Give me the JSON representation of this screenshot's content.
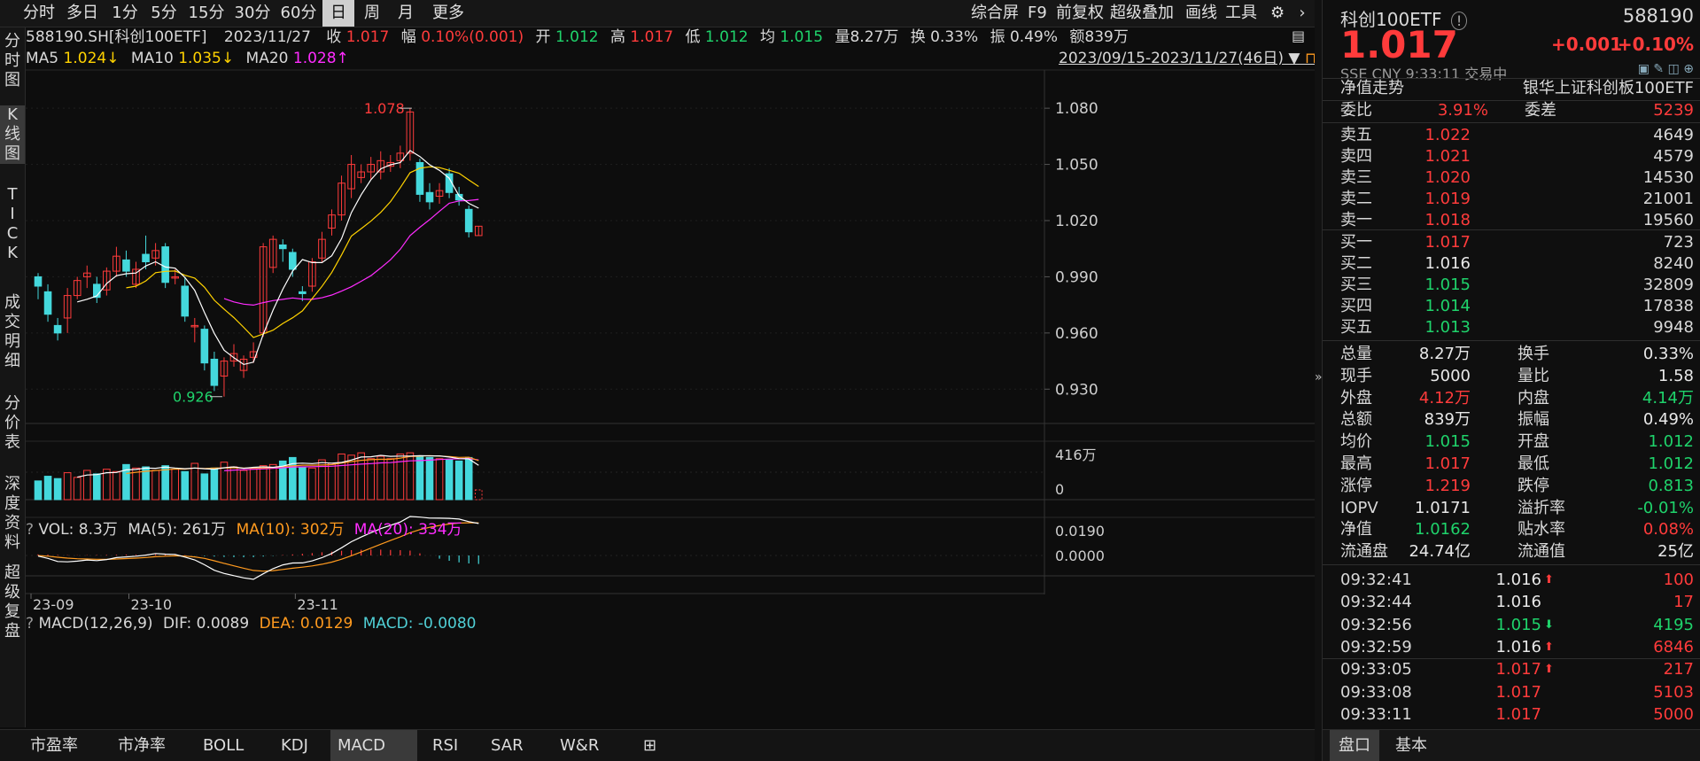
{
  "toolbar": {
    "periods": [
      "分时",
      "多日",
      "1分",
      "5分",
      "15分",
      "30分",
      "60分",
      "日",
      "周",
      "月",
      "更多"
    ],
    "active_period": "日",
    "right_tools": [
      "综合屏",
      "F9",
      "前复权",
      "超级叠加",
      "画线",
      "工具"
    ]
  },
  "sidebar": {
    "items": [
      "分时图",
      "K线图",
      "TICK",
      "成交明细",
      "分价表",
      "深度资料",
      "超级复盘"
    ],
    "active": "K线图"
  },
  "info": {
    "code": "588190.SH[科创100ETF]",
    "date": "2023/11/27",
    "close_label": "收",
    "close": "1.017",
    "change_label": "幅",
    "change": "0.10%(0.001)",
    "open_label": "开",
    "open": "1.012",
    "high_label": "高",
    "high": "1.017",
    "low_label": "低",
    "low": "1.012",
    "avg_label": "均",
    "avg": "1.015",
    "vol_label": "量",
    "vol": "8.27万",
    "turnover_label": "换",
    "turnover": "0.33%",
    "amp_label": "振",
    "amp": "0.49%",
    "amount_label": "额",
    "amount": "839万",
    "range": "2023/09/15-2023/11/27(46日)"
  },
  "ma": {
    "ma5_label": "MA5",
    "ma5": "1.024↓",
    "ma10_label": "MA10",
    "ma10": "1.035↓",
    "ma20_label": "MA20",
    "ma20": "1.028↑"
  },
  "vol_line": {
    "label": "VOL: 8.3万",
    "ma5": "MA(5): 261万",
    "ma10": "MA(10): 302万",
    "ma20": "MA(20): 334万",
    "axis_top": "416万",
    "axis_zero": "0"
  },
  "macd_line": {
    "label": "MACD(12,26,9)",
    "dif": "DIF: 0.0089",
    "dea": "DEA: 0.0129",
    "macd": "MACD: -0.0080",
    "axis_top": "0.0190",
    "axis_zero": "0.0000"
  },
  "kline_axis": [
    "1.080",
    "1.050",
    "1.020",
    "0.990",
    "0.960",
    "0.930"
  ],
  "xaxis": [
    "23-09",
    "23-10",
    "23-11"
  ],
  "annotations": {
    "high": "1.078",
    "low": "0.926"
  },
  "colors": {
    "up": "#ff3b3b",
    "down": "#44d8dc",
    "ma5": "#ffffff",
    "ma10": "#ffd200",
    "ma20": "#ff2cff",
    "bg": "#0d0d0d"
  },
  "bottom_tabs": [
    "市盈率",
    "市净率",
    "BOLL",
    "KDJ",
    "MACD",
    "RSI",
    "SAR",
    "W&R"
  ],
  "active_tab": "MACD",
  "quote": {
    "name": "科创100ETF",
    "code": "588190",
    "price": "1.017",
    "change": "+0.001",
    "change_pct": "+0.10%",
    "market": "SSE  CNY  9:33:11  交易中",
    "nav_trend": "净值走势",
    "index_name": "银华上证科创板100ETF",
    "wb_label": "委比",
    "wb": "3.91%",
    "wc_label": "委差",
    "wc": "5239"
  },
  "orderbook": {
    "sells": [
      {
        "label": "卖五",
        "price": "1.022",
        "vol": "4649"
      },
      {
        "label": "卖四",
        "price": "1.021",
        "vol": "4579"
      },
      {
        "label": "卖三",
        "price": "1.020",
        "vol": "14530"
      },
      {
        "label": "卖二",
        "price": "1.019",
        "vol": "21001"
      },
      {
        "label": "卖一",
        "price": "1.018",
        "vol": "19560"
      }
    ],
    "buys": [
      {
        "label": "买一",
        "price": "1.017",
        "vol": "723",
        "color": "red"
      },
      {
        "label": "买二",
        "price": "1.016",
        "vol": "8240",
        "color": "white"
      },
      {
        "label": "买三",
        "price": "1.015",
        "vol": "32809",
        "color": "green"
      },
      {
        "label": "买四",
        "price": "1.014",
        "vol": "17838",
        "color": "green"
      },
      {
        "label": "买五",
        "price": "1.013",
        "vol": "9948",
        "color": "green"
      }
    ]
  },
  "stats": [
    {
      "l1": "总量",
      "v1": "8.27万",
      "c1": "white",
      "l2": "换手",
      "v2": "0.33%",
      "c2": "white"
    },
    {
      "l1": "现手",
      "v1": "5000",
      "c1": "white",
      "l2": "量比",
      "v2": "1.58",
      "c2": "white"
    },
    {
      "l1": "外盘",
      "v1": "4.12万",
      "c1": "red",
      "l2": "内盘",
      "v2": "4.14万",
      "c2": "green"
    },
    {
      "l1": "总额",
      "v1": "839万",
      "c1": "white",
      "l2": "振幅",
      "v2": "0.49%",
      "c2": "white"
    },
    {
      "l1": "均价",
      "v1": "1.015",
      "c1": "green",
      "l2": "开盘",
      "v2": "1.012",
      "c2": "green"
    },
    {
      "l1": "最高",
      "v1": "1.017",
      "c1": "red",
      "l2": "最低",
      "v2": "1.012",
      "c2": "green"
    },
    {
      "l1": "涨停",
      "v1": "1.219",
      "c1": "red",
      "l2": "跌停",
      "v2": "0.813",
      "c2": "green"
    },
    {
      "l1": "IOPV",
      "v1": "1.0171",
      "c1": "white",
      "l2": "溢折率",
      "v2": "-0.01%",
      "c2": "green"
    },
    {
      "l1": "净值",
      "v1": "1.0162",
      "c1": "green",
      "l2": "贴水率",
      "v2": "0.08%",
      "c2": "red"
    },
    {
      "l1": "流通盘",
      "v1": "24.74亿",
      "c1": "white",
      "l2": "流通值",
      "v2": "25亿",
      "c2": "white"
    }
  ],
  "ticks": [
    {
      "time": "09:32:41",
      "price": "1.016",
      "pc": "white",
      "arrow": "up",
      "vol": "100",
      "vc": "red"
    },
    {
      "time": "09:32:44",
      "price": "1.016",
      "pc": "white",
      "arrow": "",
      "vol": "17",
      "vc": "red"
    },
    {
      "time": "09:32:56",
      "price": "1.015",
      "pc": "green",
      "arrow": "down",
      "vol": "4195",
      "vc": "green"
    },
    {
      "time": "09:32:59",
      "price": "1.016",
      "pc": "white",
      "arrow": "up",
      "vol": "6846",
      "vc": "red"
    },
    {
      "time": "09:33:05",
      "price": "1.017",
      "pc": "red",
      "arrow": "up",
      "vol": "217",
      "vc": "red"
    },
    {
      "time": "09:33:08",
      "price": "1.017",
      "pc": "red",
      "arrow": "",
      "vol": "5103",
      "vc": "red"
    },
    {
      "time": "09:33:11",
      "price": "1.017",
      "pc": "red",
      "arrow": "",
      "vol": "5000",
      "vc": "red"
    }
  ],
  "panel_tabs": [
    "盘口",
    "基本"
  ],
  "active_panel_tab": "盘口",
  "chart_data": {
    "type": "candlestick",
    "ylim": [
      0.92,
      1.085
    ],
    "candles": [
      {
        "o": 0.99,
        "c": 0.985,
        "h": 0.992,
        "l": 0.978
      },
      {
        "o": 0.982,
        "c": 0.97,
        "h": 0.986,
        "l": 0.966
      },
      {
        "o": 0.964,
        "c": 0.96,
        "h": 0.968,
        "l": 0.956
      },
      {
        "o": 0.968,
        "c": 0.98,
        "h": 0.984,
        "l": 0.96
      },
      {
        "o": 0.98,
        "c": 0.988,
        "h": 0.99,
        "l": 0.978
      },
      {
        "o": 0.99,
        "c": 0.992,
        "h": 0.996,
        "l": 0.984
      },
      {
        "o": 0.986,
        "c": 0.979,
        "h": 0.99,
        "l": 0.976
      },
      {
        "o": 0.983,
        "c": 0.993,
        "h": 0.995,
        "l": 0.98
      },
      {
        "o": 0.993,
        "c": 1.001,
        "h": 1.006,
        "l": 0.99
      },
      {
        "o": 0.999,
        "c": 0.993,
        "h": 1.004,
        "l": 0.99
      },
      {
        "o": 0.986,
        "c": 0.994,
        "h": 0.998,
        "l": 0.984
      },
      {
        "o": 1.002,
        "c": 0.998,
        "h": 1.012,
        "l": 0.994
      },
      {
        "o": 1.0,
        "c": 1.004,
        "h": 1.008,
        "l": 0.996
      },
      {
        "o": 1.006,
        "c": 0.987,
        "h": 1.008,
        "l": 0.984
      },
      {
        "o": 0.99,
        "c": 0.99,
        "h": 0.994,
        "l": 0.986
      },
      {
        "o": 0.985,
        "c": 0.969,
        "h": 0.99,
        "l": 0.966
      },
      {
        "o": 0.964,
        "c": 0.964,
        "h": 0.968,
        "l": 0.955
      },
      {
        "o": 0.962,
        "c": 0.944,
        "h": 0.964,
        "l": 0.94
      },
      {
        "o": 0.946,
        "c": 0.932,
        "h": 0.95,
        "l": 0.929
      },
      {
        "o": 0.937,
        "c": 0.945,
        "h": 0.947,
        "l": 0.926
      },
      {
        "o": 0.945,
        "c": 0.949,
        "h": 0.954,
        "l": 0.942
      },
      {
        "o": 0.94,
        "c": 0.946,
        "h": 0.948,
        "l": 0.936
      },
      {
        "o": 0.947,
        "c": 0.95,
        "h": 0.955,
        "l": 0.944
      },
      {
        "o": 0.96,
        "c": 1.006,
        "h": 1.008,
        "l": 0.958
      },
      {
        "o": 0.995,
        "c": 1.01,
        "h": 1.012,
        "l": 0.992
      },
      {
        "o": 1.007,
        "c": 1.005,
        "h": 1.01,
        "l": 0.998
      },
      {
        "o": 1.003,
        "c": 0.994,
        "h": 1.005,
        "l": 0.99
      },
      {
        "o": 0.982,
        "c": 0.981,
        "h": 0.985,
        "l": 0.977
      },
      {
        "o": 0.985,
        "c": 0.998,
        "h": 1.0,
        "l": 0.982
      },
      {
        "o": 1.0,
        "c": 1.01,
        "h": 1.014,
        "l": 0.998
      },
      {
        "o": 1.016,
        "c": 1.023,
        "h": 1.026,
        "l": 1.012
      },
      {
        "o": 1.023,
        "c": 1.04,
        "h": 1.044,
        "l": 1.02
      },
      {
        "o": 1.037,
        "c": 1.05,
        "h": 1.055,
        "l": 1.032
      },
      {
        "o": 1.043,
        "c": 1.046,
        "h": 1.05,
        "l": 1.04
      },
      {
        "o": 1.046,
        "c": 1.05,
        "h": 1.054,
        "l": 1.042
      },
      {
        "o": 1.046,
        "c": 1.052,
        "h": 1.057,
        "l": 1.042
      },
      {
        "o": 1.049,
        "c": 1.051,
        "h": 1.055,
        "l": 1.046
      },
      {
        "o": 1.052,
        "c": 1.056,
        "h": 1.06,
        "l": 1.048
      },
      {
        "o": 1.056,
        "c": 1.078,
        "h": 1.08,
        "l": 1.052
      },
      {
        "o": 1.051,
        "c": 1.034,
        "h": 1.053,
        "l": 1.03
      },
      {
        "o": 1.035,
        "c": 1.03,
        "h": 1.04,
        "l": 1.026
      },
      {
        "o": 1.033,
        "c": 1.036,
        "h": 1.04,
        "l": 1.029
      },
      {
        "o": 1.045,
        "c": 1.035,
        "h": 1.048,
        "l": 1.032
      },
      {
        "o": 1.034,
        "c": 1.031,
        "h": 1.038,
        "l": 1.028
      },
      {
        "o": 1.026,
        "c": 1.014,
        "h": 1.028,
        "l": 1.011
      },
      {
        "o": 1.012,
        "c": 1.017,
        "h": 1.017,
        "l": 1.012
      }
    ],
    "volumes": [
      1.6,
      2.0,
      1.8,
      2.3,
      1.9,
      2.5,
      2.2,
      2.6,
      2.4,
      3.0,
      2.7,
      2.8,
      2.5,
      2.9,
      2.6,
      2.4,
      3.1,
      2.2,
      2.7,
      3.2,
      2.8,
      2.5,
      2.6,
      2.9,
      3.0,
      3.3,
      3.6,
      2.8,
      2.7,
      3.4,
      3.1,
      3.9,
      3.8,
      4.0,
      3.5,
      3.7,
      3.5,
      3.9,
      4.0,
      3.7,
      3.6,
      3.5,
      3.4,
      3.3,
      3.6,
      0.83
    ],
    "macd": [
      0.001,
      0.0008,
      0.0005,
      0.0003,
      0.0002,
      0.0003,
      0.0004,
      0.0005,
      0.0006,
      0.0008,
      0.0007,
      0.0009,
      0.001,
      0.0008,
      0.0006,
      0.0003,
      -0.0002,
      -0.0006,
      -0.001,
      -0.0014,
      -0.0016,
      -0.0017,
      -0.0016,
      -0.001,
      -0.0004,
      0.0004,
      0.001,
      0.0016,
      0.0022,
      0.003,
      0.0036,
      0.0044,
      0.005,
      0.0054,
      0.0056,
      0.0055,
      0.0052,
      0.005,
      0.0046,
      0.002,
      0.0,
      -0.003,
      -0.005,
      -0.0065,
      -0.0075,
      -0.008
    ]
  }
}
